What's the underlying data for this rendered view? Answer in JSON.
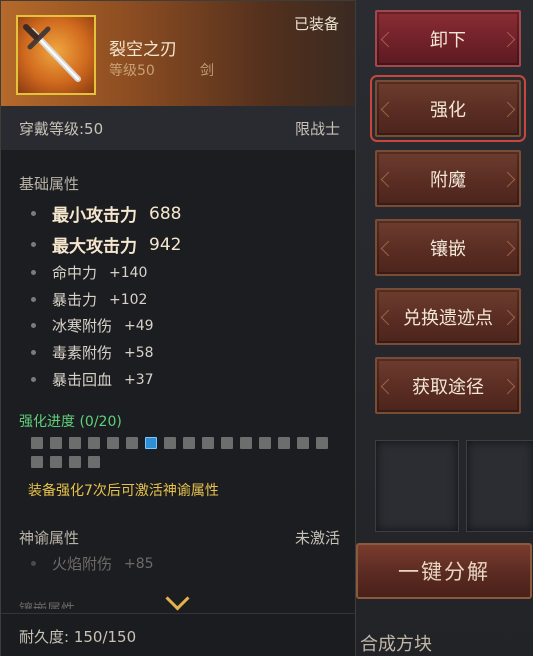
{
  "item": {
    "name": "裂空之刃",
    "level": "等级50",
    "type": "剑",
    "equipped_label": "已装备",
    "icon": "sword-icon",
    "border_color": "#e4c23a"
  },
  "requirement": {
    "level": "穿戴等级:50",
    "class": "限战士"
  },
  "base_attrs": {
    "title": "基础属性",
    "rows": [
      {
        "name": "最小攻击力",
        "value": "688"
      },
      {
        "name": "最大攻击力",
        "value": "942"
      },
      {
        "name": "命中力",
        "value": "+140"
      },
      {
        "name": "暴击力",
        "value": "+102"
      },
      {
        "name": "冰寒附伤",
        "value": "+49"
      },
      {
        "name": "毒素附伤",
        "value": "+58"
      },
      {
        "name": "暴击回血",
        "value": "+37"
      }
    ]
  },
  "enhance": {
    "title": "强化进度 (0/20)",
    "total": 20,
    "current": 0,
    "highlight_index": 6,
    "hint": "装备强化7次后可激活神谕属性"
  },
  "oracle": {
    "title": "神谕属性",
    "status": "未激活",
    "rows": [
      {
        "name": "火焰附伤",
        "value": "+85"
      }
    ]
  },
  "more_section": "镶嵌属性",
  "durability": "耐久度: 150/150",
  "actions": [
    "卸下",
    "强化",
    "附魔",
    "镶嵌",
    "兑换遗迹点",
    "获取途径"
  ],
  "background": {
    "decompose_button": "一键分解",
    "bottom_text": "合成方块"
  }
}
